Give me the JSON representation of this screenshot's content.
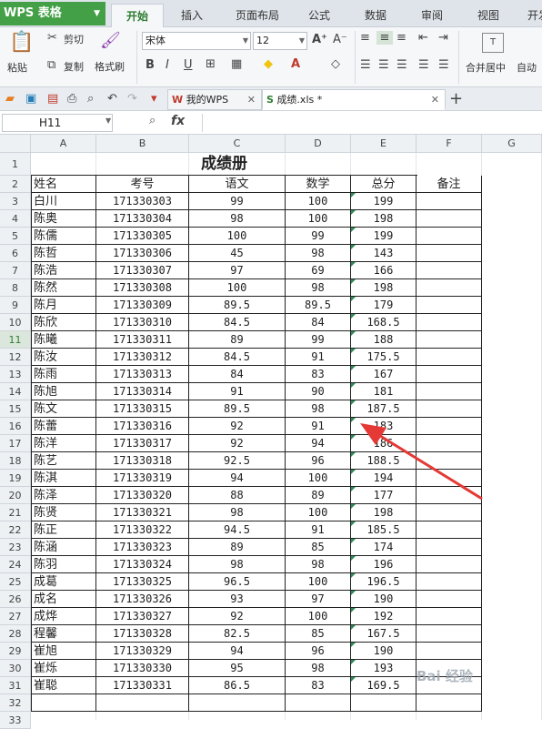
{
  "app": {
    "logo": "WPS 表格"
  },
  "tabs": [
    "开始",
    "插入",
    "页面布局",
    "公式",
    "数据",
    "审阅",
    "视图",
    "开发"
  ],
  "ribbon": {
    "paste": "粘贴",
    "cut": "剪切",
    "copy": "复制",
    "format_painter": "格式刷",
    "font": "宋体",
    "size": "12",
    "merge_center": "合并居中",
    "auto_wrap": "自动"
  },
  "doc_tabs": [
    {
      "label": "我的WPS"
    },
    {
      "label": "成绩.xls *"
    }
  ],
  "formula_bar": {
    "cell_ref": "H11",
    "fx": "fx",
    "value": ""
  },
  "columns": [
    "A",
    "B",
    "C",
    "D",
    "E",
    "F",
    "G"
  ],
  "sheet": {
    "title": "成绩册",
    "headers": [
      "姓名",
      "考号",
      "语文",
      "数学",
      "总分",
      "备注"
    ],
    "rows": [
      [
        "白川",
        "171330303",
        "99",
        "100",
        "199"
      ],
      [
        "陈奥",
        "171330304",
        "98",
        "100",
        "198"
      ],
      [
        "陈儒",
        "171330305",
        "100",
        "99",
        "199"
      ],
      [
        "陈哲",
        "171330306",
        "45",
        "98",
        "143"
      ],
      [
        "陈浩",
        "171330307",
        "97",
        "69",
        "166"
      ],
      [
        "陈然",
        "171330308",
        "100",
        "98",
        "198"
      ],
      [
        "陈月",
        "171330309",
        "89.5",
        "89.5",
        "179"
      ],
      [
        "陈欣",
        "171330310",
        "84.5",
        "84",
        "168.5"
      ],
      [
        "陈曦",
        "171330311",
        "89",
        "99",
        "188"
      ],
      [
        "陈汝",
        "171330312",
        "84.5",
        "91",
        "175.5"
      ],
      [
        "陈雨",
        "171330313",
        "84",
        "83",
        "167"
      ],
      [
        "陈旭",
        "171330314",
        "91",
        "90",
        "181"
      ],
      [
        "陈文",
        "171330315",
        "89.5",
        "98",
        "187.5"
      ],
      [
        "陈蕾",
        "171330316",
        "92",
        "91",
        "183"
      ],
      [
        "陈洋",
        "171330317",
        "92",
        "94",
        "186"
      ],
      [
        "陈艺",
        "171330318",
        "92.5",
        "96",
        "188.5"
      ],
      [
        "陈淇",
        "171330319",
        "94",
        "100",
        "194"
      ],
      [
        "陈泽",
        "171330320",
        "88",
        "89",
        "177"
      ],
      [
        "陈贤",
        "171330321",
        "98",
        "100",
        "198"
      ],
      [
        "陈正",
        "171330322",
        "94.5",
        "91",
        "185.5"
      ],
      [
        "陈涵",
        "171330323",
        "89",
        "85",
        "174"
      ],
      [
        "陈羽",
        "171330324",
        "98",
        "98",
        "196"
      ],
      [
        "成葛",
        "171330325",
        "96.5",
        "100",
        "196.5"
      ],
      [
        "成名",
        "171330326",
        "93",
        "97",
        "190"
      ],
      [
        "成烨",
        "171330327",
        "92",
        "100",
        "192"
      ],
      [
        "程馨",
        "171330328",
        "82.5",
        "85",
        "167.5"
      ],
      [
        "崔旭",
        "171330329",
        "94",
        "96",
        "190"
      ],
      [
        "崔烁",
        "171330330",
        "95",
        "98",
        "193"
      ],
      [
        "崔聪",
        "171330331",
        "86.5",
        "83",
        "169.5"
      ]
    ]
  },
  "row_numbers": [
    "1",
    "2",
    "3",
    "4",
    "5",
    "6",
    "7",
    "8",
    "9",
    "10",
    "11",
    "12",
    "13",
    "14",
    "15",
    "16",
    "17",
    "18",
    "19",
    "20",
    "21",
    "22",
    "23",
    "24",
    "25",
    "26",
    "27",
    "28",
    "29",
    "30",
    "31",
    "32",
    "33"
  ],
  "selected_row": "11",
  "watermark": "Bai 经验",
  "colors": {
    "accent": "#43a047",
    "arrow": "#e53935",
    "flag": "#2e8b57"
  }
}
